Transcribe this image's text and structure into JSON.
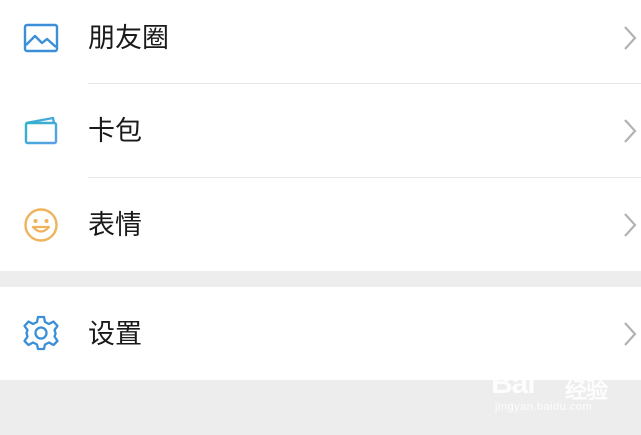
{
  "menu": {
    "items": [
      {
        "label": "朋友圈",
        "icon": "photo-icon"
      },
      {
        "label": "卡包",
        "icon": "card-wallet-icon"
      },
      {
        "label": "表情",
        "icon": "smiley-icon"
      }
    ],
    "settings": {
      "label": "设置",
      "icon": "gear-icon"
    }
  },
  "colors": {
    "photo_icon": "#3a8fd8",
    "wallet_icon_a": "#2eb3c8",
    "wallet_icon_b": "#5aa0e6",
    "smiley_icon": "#f0b25a",
    "gear_icon": "#3a8fd8",
    "chevron": "#b2b2b2"
  },
  "watermark": {
    "brand": "Bai",
    "brand_suffix": "经验",
    "url": "jingyan.baidu.com"
  }
}
